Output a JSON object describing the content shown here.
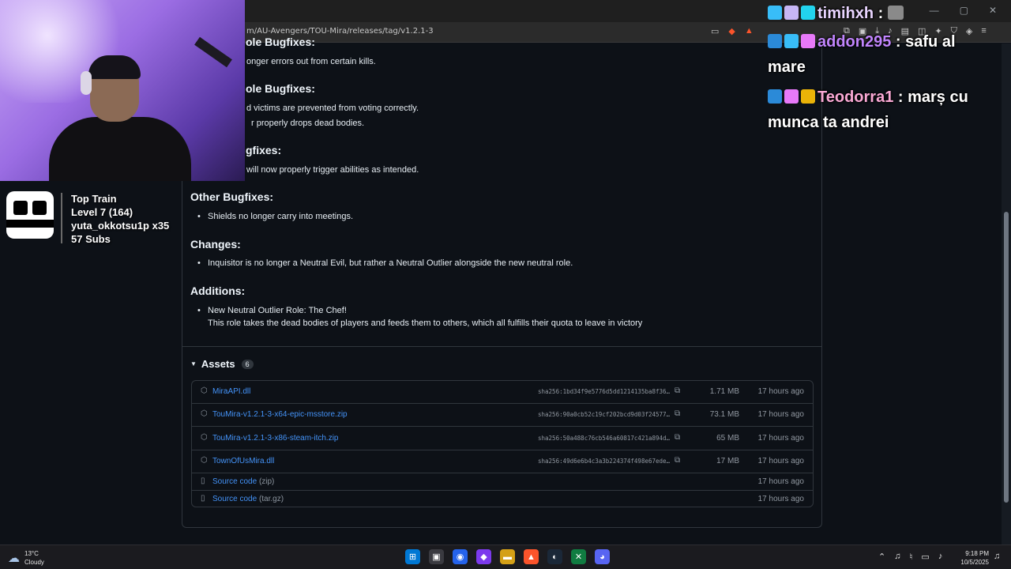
{
  "browser": {
    "url": "m/AU-Avengers/TOU-Mira/releases/tag/v1.2.1-3",
    "window_controls": [
      "—",
      "▢",
      "✕"
    ]
  },
  "release_notes": {
    "lines": [
      {
        "kind": "heading",
        "text": "ole Bugfixes:"
      },
      {
        "kind": "bullet",
        "text": "onger errors out from certain kills."
      },
      {
        "kind": "heading",
        "text": "ole Bugfixes:"
      },
      {
        "kind": "bullet",
        "text": "d victims are prevented from voting correctly."
      },
      {
        "kind": "bullet",
        "text": "r properly drops dead bodies."
      },
      {
        "kind": "heading",
        "text": "gfixes:"
      },
      {
        "kind": "bullet",
        "text": "will now properly trigger abilities as intended."
      },
      {
        "kind": "heading",
        "text": "Other Bugfixes:"
      },
      {
        "kind": "bullet",
        "text": "Shields no longer carry into meetings."
      },
      {
        "kind": "heading",
        "text": "Changes:"
      },
      {
        "kind": "bullet",
        "text": "Inquisitor is no longer a Neutral Evil, but rather a Neutral Outlier alongside the new neutral role."
      },
      {
        "kind": "heading",
        "text": "Additions:"
      },
      {
        "kind": "bullet",
        "text": "New Neutral Outlier Role: The Chef!"
      },
      {
        "kind": "text",
        "text": "This role takes the dead bodies of players and feeds them to others, which all fulfills their quota to leave in victory"
      }
    ]
  },
  "assets": {
    "title": "Assets",
    "count": "6",
    "items": [
      {
        "icon": "package-icon",
        "name": "MiraAPI.dll",
        "paren": "",
        "sha": "sha256:1bd34f9e5776d5dd1214135ba8f36…",
        "size": "1.71 MB",
        "time": "17 hours ago"
      },
      {
        "icon": "package-icon",
        "name": "TouMira-v1.2.1-3-x64-epic-msstore.zip",
        "paren": "",
        "sha": "sha256:90a0cb52c19cf202bcd9d03f24577…",
        "size": "73.1 MB",
        "time": "17 hours ago"
      },
      {
        "icon": "package-icon",
        "name": "TouMira-v1.2.1-3-x86-steam-itch.zip",
        "paren": "",
        "sha": "sha256:50a488c76cb546a60817c421a894d…",
        "size": "65 MB",
        "time": "17 hours ago"
      },
      {
        "icon": "package-icon",
        "name": "TownOfUsMira.dll",
        "paren": "",
        "sha": "sha256:49d6e6b4c3a3b224374f498e67ede…",
        "size": "17 MB",
        "time": "17 hours ago"
      },
      {
        "icon": "file-zip-icon",
        "name": "Source code",
        "paren": "(zip)",
        "sha": "",
        "size": "",
        "time": "17 hours ago"
      },
      {
        "icon": "file-zip-icon",
        "name": "Source code",
        "paren": "(tar.gz)",
        "sha": "",
        "size": "",
        "time": "17 hours ago"
      }
    ]
  },
  "top_train": {
    "title": "Top Train",
    "level": "Level 7  (164)",
    "user": "yuta_okkotsu1p x35",
    "subs": "57 Subs"
  },
  "chat": {
    "messages": [
      {
        "user": "timihxh",
        "sep": " :",
        "text": "",
        "color": "#e9d5ff"
      },
      {
        "user": "addon295",
        "sep": " :",
        "text": " safu al",
        "text2": "mare",
        "color": "#c084fc"
      },
      {
        "user": "Teodorra1",
        "sep": " :",
        "text": " marș cu",
        "text2": "munca ta andrei",
        "color": "#f9a8d4"
      }
    ]
  },
  "taskbar": {
    "temperature": "13°C",
    "condition": "Cloudy",
    "time": "9:18 PM",
    "date": "10/5/2025"
  }
}
